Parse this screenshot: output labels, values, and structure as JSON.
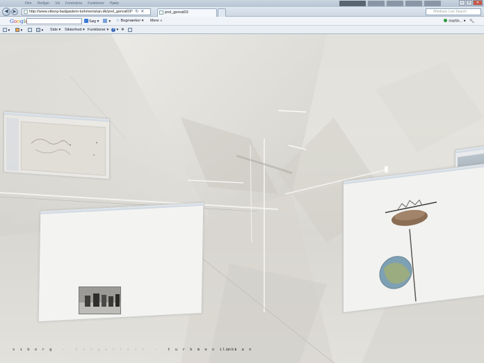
{
  "browser": {
    "menu_items": [
      "Filer",
      "Rediger",
      "Vis",
      "Foretrukne",
      "Funktioner",
      "Hjælp"
    ],
    "title_chips": [
      "",
      "",
      "",
      "",
      ""
    ],
    "address": "http://www.viborg-badgastein-turkmenistan.dk/prel_genral03",
    "tabs": [
      {
        "label": "prel_genral03"
      },
      {
        "label": ""
      }
    ],
    "search_placeholder": "Windows Live Search"
  },
  "google_toolbar": {
    "logo": [
      "G",
      "o",
      "o",
      "g",
      "l",
      "e"
    ],
    "search_label": "Søg",
    "bookmarks_label": "Bogmærker",
    "more_label": "Mere",
    "more_arrows": "»",
    "user": "martin..."
  },
  "command_bar": {
    "page_label": "Side",
    "safety_label": "Sikkerhed",
    "tools_label": "Funktioner",
    "help_label": "?"
  },
  "site_nav": {
    "viborg": "v i b o r g",
    "sep": "-",
    "badgastein": "b a d   g a s t e i n",
    "turkmenistan": "t u r k m e n i s t a n",
    "links": "links"
  },
  "colors": {
    "background": "#dcdcd8",
    "nav_active": "#2a2a2a",
    "nav_inactive": "#c7bfb8"
  },
  "icons": {
    "back": "back-arrow-icon",
    "forward": "forward-arrow-icon",
    "refresh": "refresh-icon",
    "stop": "stop-icon",
    "home": "home-icon",
    "print": "print-icon",
    "feed": "feed-icon",
    "mail": "mail-icon",
    "help": "help-icon"
  }
}
